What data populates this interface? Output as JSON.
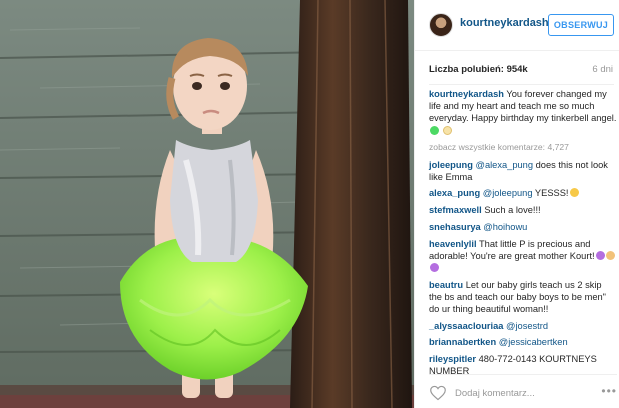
{
  "post": {
    "username": "kourtneykardash",
    "follow_label": "OBSERWUJ",
    "likes": "Liczba polubień: 954k",
    "time_ago": "6 dni"
  },
  "caption": {
    "user": "kourtneykardash",
    "text": "You forever changed my life and my heart and teach me so much everyday. Happy birthday my tinkerbell angel."
  },
  "load_more": "zobacz wszystkie komentarze: 4,727",
  "comments": [
    {
      "user": "joleepung",
      "mention": "@alexa_pung",
      "text": " does this not look like Emma"
    },
    {
      "user": "alexa_pung",
      "mention": "@joleepung",
      "text": " YESSS!"
    },
    {
      "user": "stefmaxwell",
      "mention": "",
      "text": "Such a love!!!"
    },
    {
      "user": "snehasurya",
      "mention": "@hoihowu",
      "text": ""
    },
    {
      "user": "heavenlylil",
      "mention": "",
      "text": "That little P is precious and adorable! You're are great mother Kourt!"
    },
    {
      "user": "beautru",
      "mention": "",
      "text": "Let our baby girls teach us 2 skip the bs and teach our baby boys to be men\" do ur thing beautiful woman!!"
    },
    {
      "user": "_alyssaaclouriaa",
      "mention": "@josestrd",
      "text": ""
    },
    {
      "user": "briannabertken",
      "mention": "@jessicabertken",
      "text": ""
    },
    {
      "user": "rileyspitler",
      "mention": "",
      "text": "480-772-0143 KOURTNEYS NUMBER"
    }
  ],
  "footer": {
    "add_comment_placeholder": "Dodaj komentarz...",
    "more_label": "•••"
  },
  "icons": {
    "heart": "heart-icon",
    "more": "more-options-icon",
    "avatar": "avatar"
  },
  "colors": {
    "link": "#125688",
    "accent": "#3897f0",
    "muted": "#999999"
  }
}
